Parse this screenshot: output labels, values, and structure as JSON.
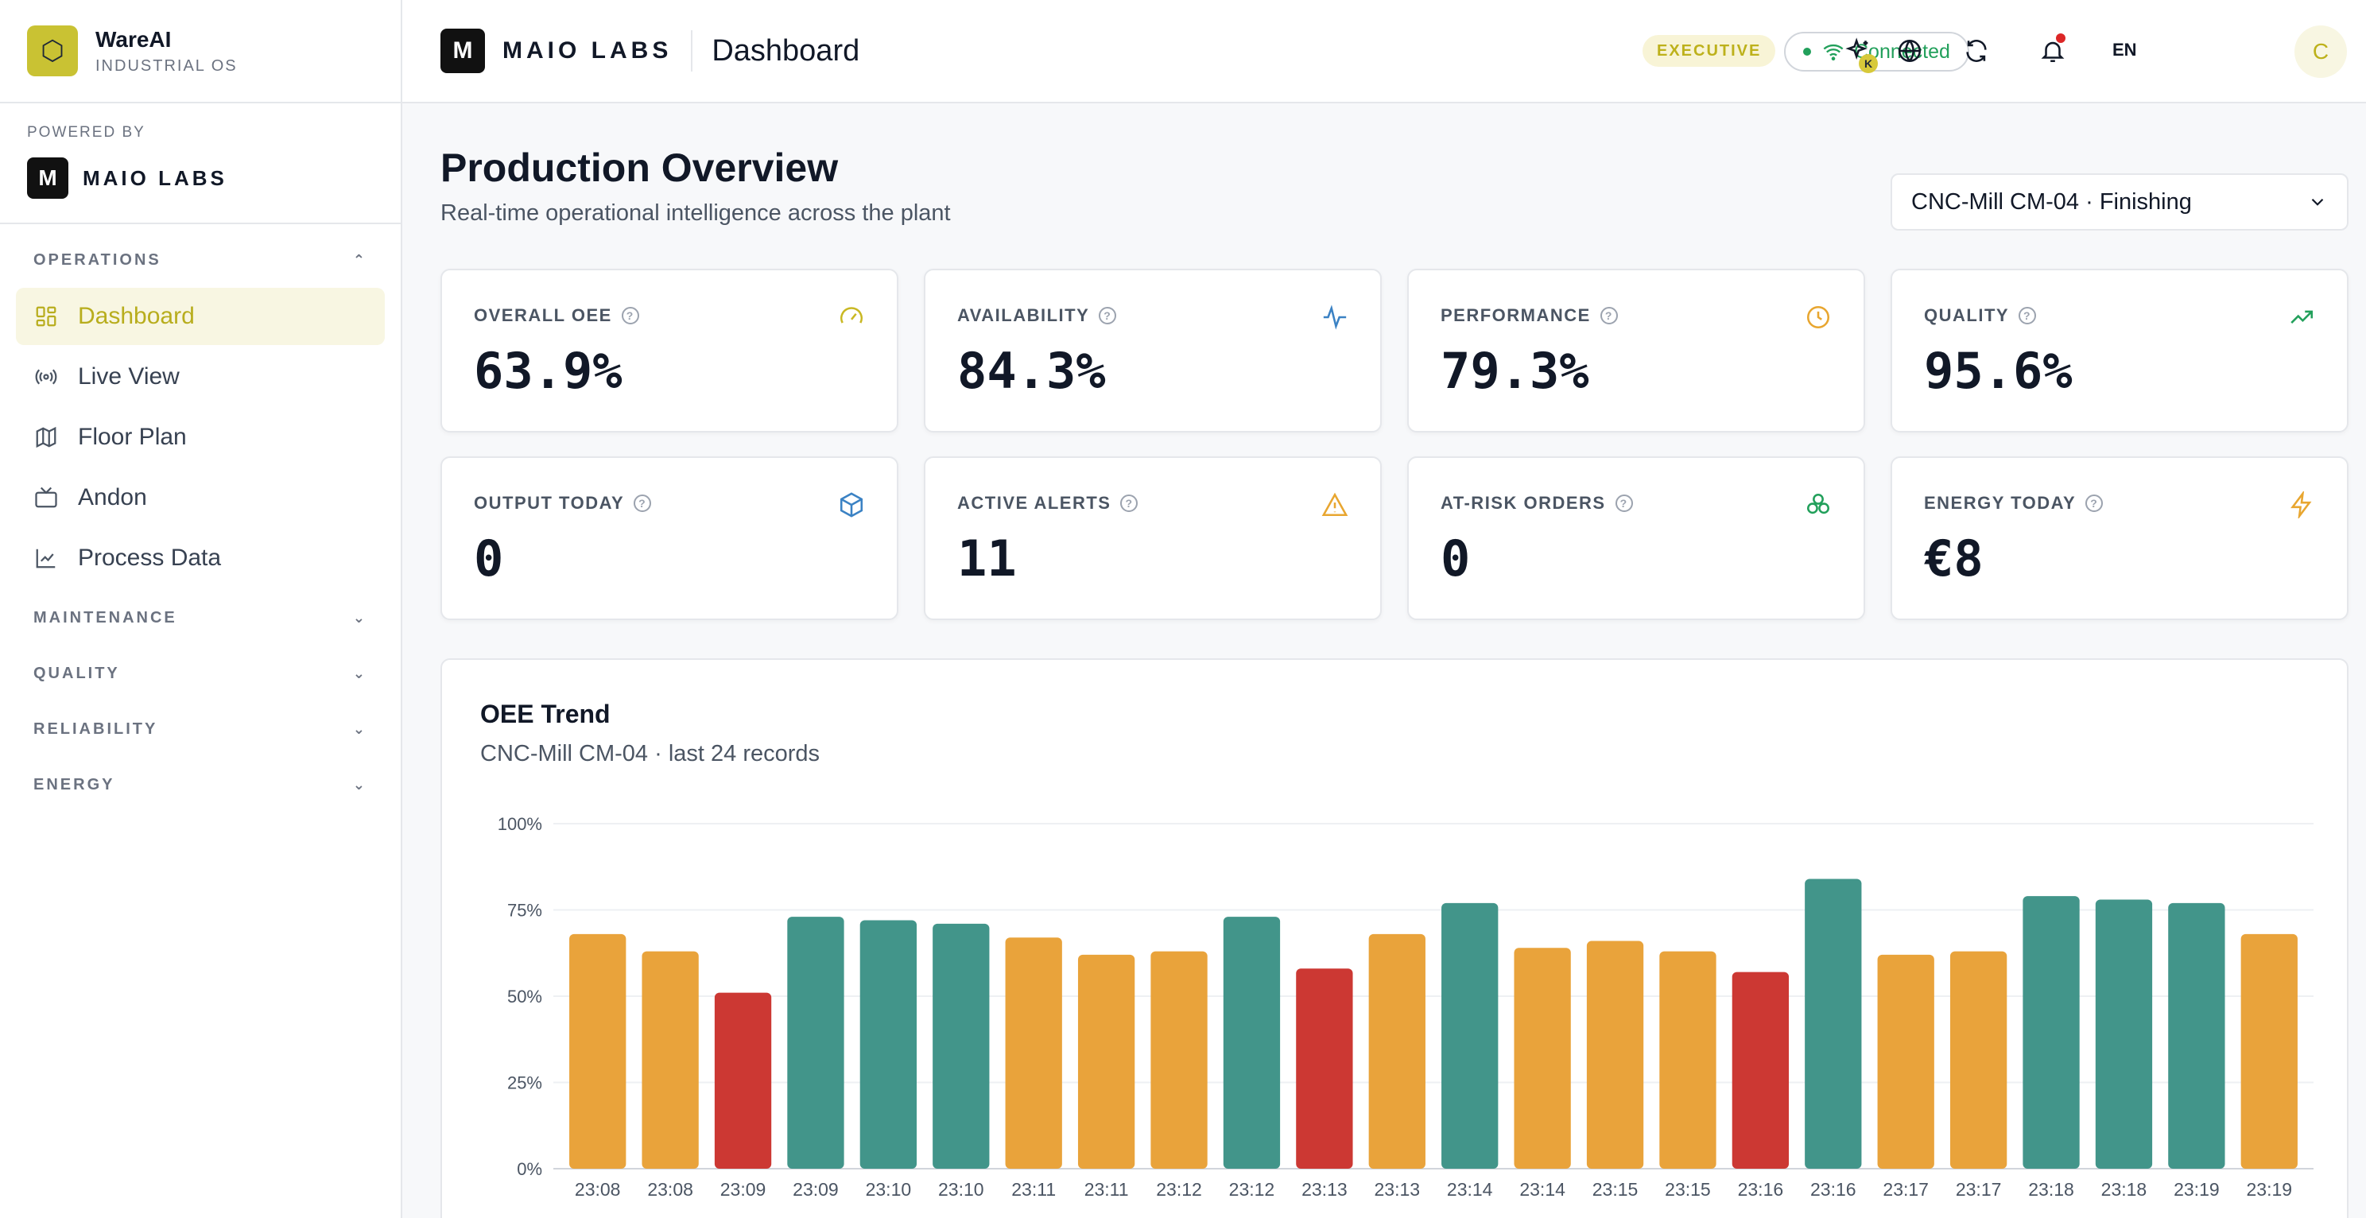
{
  "app": {
    "name": "WareAI",
    "subtitle": "INDUSTRIAL OS",
    "logo_icon": "hexagon-icon",
    "powered_by_label": "POWERED BY",
    "powered_by_name": "MAIO LABS",
    "powered_by_mark": "M"
  },
  "sidebar": {
    "sections": [
      {
        "label": "OPERATIONS",
        "expanded": true,
        "items": [
          {
            "label": "Dashboard",
            "icon": "dashboard-icon",
            "active": true
          },
          {
            "label": "Live View",
            "icon": "broadcast-icon"
          },
          {
            "label": "Floor Plan",
            "icon": "map-icon"
          },
          {
            "label": "Andon",
            "icon": "tv-icon"
          },
          {
            "label": "Process Data",
            "icon": "line-chart-icon"
          }
        ]
      },
      {
        "label": "MAINTENANCE",
        "expanded": false
      },
      {
        "label": "QUALITY",
        "expanded": false
      },
      {
        "label": "RELIABILITY",
        "expanded": false
      },
      {
        "label": "ENERGY",
        "expanded": false
      }
    ]
  },
  "header": {
    "mark": "M",
    "brand": "MAIO LABS",
    "title": "Dashboard",
    "role_badge": "EXECUTIVE",
    "connection_status": "Connected",
    "assistant_badge": "K",
    "language": "EN",
    "avatar_initial": "C"
  },
  "page": {
    "title": "Production Overview",
    "subtitle": "Real-time operational intelligence across the plant",
    "machine_select": "CNC-Mill CM-04 · Finishing"
  },
  "kpis": [
    {
      "label": "OVERALL OEE",
      "value": "63.9%",
      "icon": "gauge-icon",
      "color": "#c9b823"
    },
    {
      "label": "AVAILABILITY",
      "value": "84.3%",
      "icon": "activity-icon",
      "color": "#3b82c4"
    },
    {
      "label": "PERFORMANCE",
      "value": "79.3%",
      "icon": "clock-icon",
      "color": "#e8a630"
    },
    {
      "label": "QUALITY",
      "value": "95.6%",
      "icon": "trending-up-icon",
      "color": "#22a05b"
    },
    {
      "label": "OUTPUT TODAY",
      "value": "0",
      "icon": "box-icon",
      "color": "#3b82c4"
    },
    {
      "label": "ACTIVE ALERTS",
      "value": "11",
      "icon": "warning-icon",
      "color": "#e8a630"
    },
    {
      "label": "AT-RISK ORDERS",
      "value": "0",
      "icon": "boxes-icon",
      "color": "#22a05b"
    },
    {
      "label": "ENERGY TODAY",
      "value": "€8",
      "icon": "lightning-icon",
      "color": "#e8a630"
    }
  ],
  "chart": {
    "title": "OEE Trend",
    "subtitle": "CNC-Mill CM-04 · last 24 records"
  },
  "chart_data": {
    "type": "bar",
    "title": "OEE Trend",
    "categories": [
      "23:08",
      "23:08",
      "23:09",
      "23:09",
      "23:10",
      "23:10",
      "23:11",
      "23:11",
      "23:12",
      "23:12",
      "23:13",
      "23:13",
      "23:14",
      "23:14",
      "23:15",
      "23:15",
      "23:16",
      "23:16",
      "23:17",
      "23:17",
      "23:18",
      "23:18",
      "23:19",
      "23:19"
    ],
    "values": [
      68,
      63,
      51,
      73,
      72,
      71,
      67,
      62,
      63,
      73,
      58,
      68,
      77,
      64,
      66,
      63,
      57,
      84,
      62,
      63,
      79,
      78,
      77,
      68
    ],
    "ylim": [
      0,
      100
    ],
    "yticks": [
      "0%",
      "25%",
      "50%",
      "75%",
      "100%"
    ],
    "grid": true,
    "colors": {
      "good": "#42958a",
      "warn": "#e9a33b",
      "bad": "#cc3833"
    }
  }
}
